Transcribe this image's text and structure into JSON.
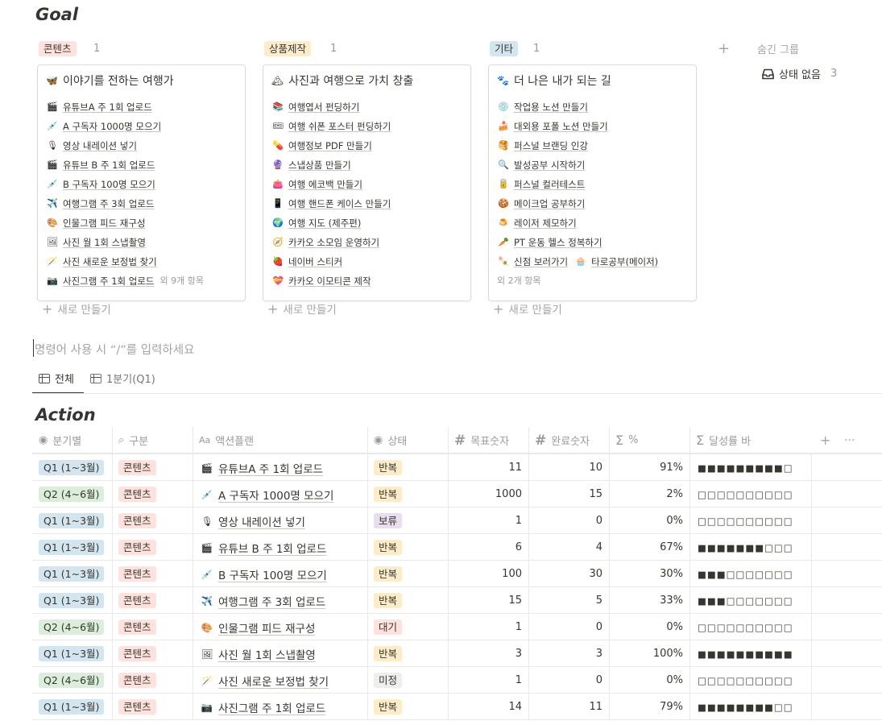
{
  "goal": {
    "title": "Goal",
    "columns": [
      {
        "tag": "콘텐츠",
        "tag_bg": "#ffe2dd",
        "count": "1",
        "card_icon": "🦋",
        "card_title": "이야기를 전하는 여행가",
        "items": [
          {
            "icon": "🎬",
            "text": "유튜브A 주 1회 업로드"
          },
          {
            "icon": "💉",
            "text": "A 구독자 1000명 모으기"
          },
          {
            "icon": "🎙",
            "text": "영상 내레이션 넣기"
          },
          {
            "icon": "🎬",
            "text": "유튜브 B 주 1회 업로드"
          },
          {
            "icon": "💉",
            "text": "B 구독자 100명 모으기"
          },
          {
            "icon": "✈️",
            "text": "여행그램 주 3회 업로드"
          },
          {
            "icon": "🎨",
            "text": "인물그램 피드 재구성"
          },
          {
            "icon": "🖼",
            "text": "사진 월 1회 스냅촬영"
          },
          {
            "icon": "🪄",
            "text": "사진 새로운 보정법 찾기"
          },
          {
            "icon": "📷",
            "text": "사진그램 주 1회 업로드",
            "more": "외 9개 항목"
          }
        ],
        "new_label": "새로 만들기"
      },
      {
        "tag": "상품제작",
        "tag_bg": "#fdecc8",
        "count": "1",
        "card_icon": "🏔",
        "card_title": "사진과 여행으로 가치 창출",
        "items": [
          {
            "icon": "📚",
            "text": "여행엽서 펀딩하기"
          },
          {
            "icon": "🎟",
            "text": "여행 쉬폰 포스터 펀딩하기"
          },
          {
            "icon": "💊",
            "text": "여행정보 PDF 만들기"
          },
          {
            "icon": "🔮",
            "text": "스냅상품 만들기"
          },
          {
            "icon": "👛",
            "text": "여행 에코백 만들기"
          },
          {
            "icon": "📱",
            "text": "여행 핸드폰 케이스 만들기"
          },
          {
            "icon": "🌍",
            "text": "여행 지도 (제주편)"
          },
          {
            "icon": "🧭",
            "text": "카카오 소모임 운영하기"
          },
          {
            "icon": "🍓",
            "text": "네이버 스티커"
          },
          {
            "icon": "💝",
            "text": "카카오 이모티콘 제작"
          }
        ],
        "new_label": "새로 만들기"
      },
      {
        "tag": "기타",
        "tag_bg": "#d3e5ef",
        "count": "1",
        "card_icon": "🐾",
        "card_title": "더 나은 내가 되는 길",
        "items": [
          {
            "icon": "💿",
            "text": "작업용 노션 만들기"
          },
          {
            "icon": "🍰",
            "text": "대외용 포폴 노션 만들기"
          },
          {
            "icon": "🥞",
            "text": "퍼스널 브랜딩 인강"
          },
          {
            "icon": "🔍",
            "text": "발성공부 시작하기"
          },
          {
            "icon": "🥫",
            "text": "퍼스널 컬러테스트"
          },
          {
            "icon": "🍪",
            "text": "메이크업 공부하기"
          },
          {
            "icon": "🍮",
            "text": "레이저 제모하기"
          },
          {
            "icon": "🥕",
            "text": "PT 운동 헬스 정복하기"
          },
          {
            "icon": "🍡",
            "text": "신점 보러가기",
            "icon2": "🧁",
            "text2": "타로공부(메이저)"
          }
        ],
        "more": "외 2개 항목",
        "new_label": "새로 만들기"
      }
    ],
    "hidden_groups": "숨긴 그룹",
    "no_status": "상태 없음",
    "no_status_count": "3"
  },
  "command_placeholder": "명령어 사용 시 “/”를 입력하세요",
  "tabs": [
    {
      "label": "전체",
      "active": true
    },
    {
      "label": "1분기(Q1)",
      "active": false
    }
  ],
  "action": {
    "title": "Action",
    "headers": {
      "quarter": "분기별",
      "category": "구분",
      "plan": "액션플랜",
      "status": "상태",
      "target": "목표숫자",
      "done": "완료숫자",
      "percent": "%",
      "progress_bar": "달성률 바"
    },
    "rows": [
      {
        "q": "Q1 (1~3월)",
        "cat": "콘텐츠",
        "icon": "🎬",
        "plan": "유튜브A 주 1회 업로드",
        "status": "반복",
        "target": "11",
        "done": "10",
        "pct": "91%",
        "bar": "■■■■■■■■■□"
      },
      {
        "q": "Q2 (4~6월)",
        "cat": "콘텐츠",
        "icon": "💉",
        "plan": "A 구독자 1000명 모으기",
        "status": "반복",
        "target": "1000",
        "done": "15",
        "pct": "2%",
        "bar": "□□□□□□□□□□"
      },
      {
        "q": "Q1 (1~3월)",
        "cat": "콘텐츠",
        "icon": "🎙",
        "plan": "영상 내레이션 넣기",
        "status": "보류",
        "target": "1",
        "done": "0",
        "pct": "0%",
        "bar": "□□□□□□□□□□"
      },
      {
        "q": "Q1 (1~3월)",
        "cat": "콘텐츠",
        "icon": "🎬",
        "plan": "유튜브 B 주 1회 업로드",
        "status": "반복",
        "target": "6",
        "done": "4",
        "pct": "67%",
        "bar": "■■■■■■■□□□"
      },
      {
        "q": "Q1 (1~3월)",
        "cat": "콘텐츠",
        "icon": "💉",
        "plan": "B 구독자 100명 모으기",
        "status": "반복",
        "target": "100",
        "done": "30",
        "pct": "30%",
        "bar": "■■■□□□□□□□"
      },
      {
        "q": "Q1 (1~3월)",
        "cat": "콘텐츠",
        "icon": "✈️",
        "plan": "여행그램 주 3회 업로드",
        "status": "반복",
        "target": "15",
        "done": "5",
        "pct": "33%",
        "bar": "■■■□□□□□□□"
      },
      {
        "q": "Q2 (4~6월)",
        "cat": "콘텐츠",
        "icon": "🎨",
        "plan": "인물그램 피드 재구성",
        "status": "대기",
        "target": "1",
        "done": "0",
        "pct": "0%",
        "bar": "□□□□□□□□□□"
      },
      {
        "q": "Q1 (1~3월)",
        "cat": "콘텐츠",
        "icon": "🖼",
        "plan": "사진 월 1회 스냅촬영",
        "status": "반복",
        "target": "3",
        "done": "3",
        "pct": "100%",
        "bar": "■■■■■■■■■■"
      },
      {
        "q": "Q2 (4~6월)",
        "cat": "콘텐츠",
        "icon": "🪄",
        "plan": "사진 새로운 보정법 찾기",
        "status": "미정",
        "target": "1",
        "done": "0",
        "pct": "0%",
        "bar": "□□□□□□□□□□"
      },
      {
        "q": "Q1 (1~3월)",
        "cat": "콘텐츠",
        "icon": "📷",
        "plan": "사진그램 주 1회 업로드",
        "status": "반복",
        "target": "14",
        "done": "11",
        "pct": "79%",
        "bar": "■■■■■■■■□□"
      }
    ]
  },
  "colors": {
    "q1": "#d3e5ef",
    "q2": "#dbeddb",
    "category": "#ffe2dd",
    "status_repeat": "#fdecc8",
    "status_hold": "#e8deee",
    "status_wait": "#ffe2dd",
    "status_undecided": "#eeeeed"
  }
}
